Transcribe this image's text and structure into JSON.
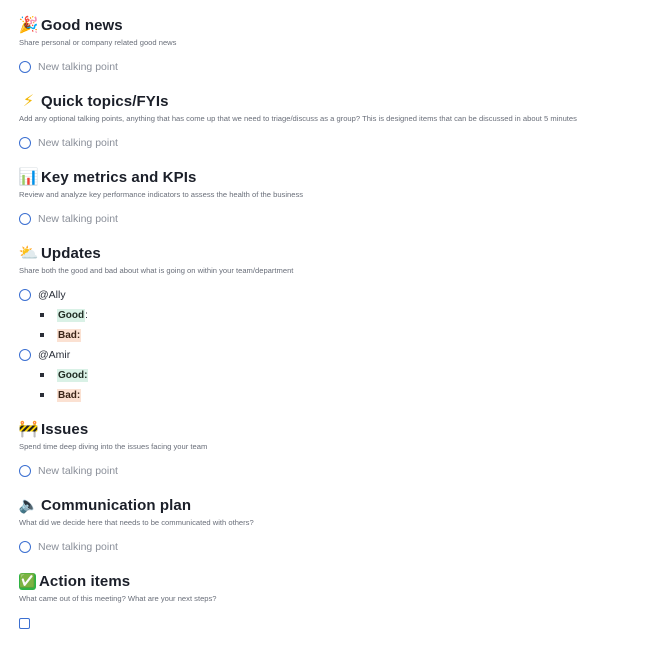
{
  "sections": [
    {
      "emoji": "🎉",
      "title": "Good news",
      "description": "Share personal or company related good news",
      "item": "New talking point"
    },
    {
      "emoji": "⚡",
      "title": "Quick topics/FYIs",
      "description": "Add any optional talking points, anything that has come up that we need to triage/discuss as a group? This is designed items that can be discussed in about 5 minutes",
      "item": "New talking point"
    },
    {
      "emoji": "📊",
      "title": "Key metrics and KPIs",
      "description": "Review and analyze key performance indicators to assess the health of the business",
      "item": "New talking point"
    },
    {
      "emoji": "⛅",
      "title": "Updates",
      "description": "Share both the good and bad about what is going on within your team/department"
    },
    {
      "emoji": "🚧",
      "title": "Issues",
      "description": "Spend time deep diving into the issues facing your team",
      "item": "New talking point"
    },
    {
      "emoji": "🔈",
      "title": "Communication plan",
      "description": "What did we decide here that needs to be communicated with others?",
      "item": "New talking point"
    },
    {
      "emoji": "✅",
      "title": "Action items",
      "description": "What came out of this meeting? What are your next steps?"
    }
  ],
  "updates": {
    "people": [
      {
        "name": "@Ally",
        "good_label": "Good",
        "good_colon": ":",
        "bad_label": "Bad:"
      },
      {
        "name": "@Amir",
        "good_label": "Good:",
        "good_colon": "",
        "bad_label": "Bad:"
      }
    ]
  },
  "colors": {
    "accent": "#3b6fd1",
    "good_bg": "#d9f1e6",
    "bad_bg": "#fbe1d2"
  }
}
